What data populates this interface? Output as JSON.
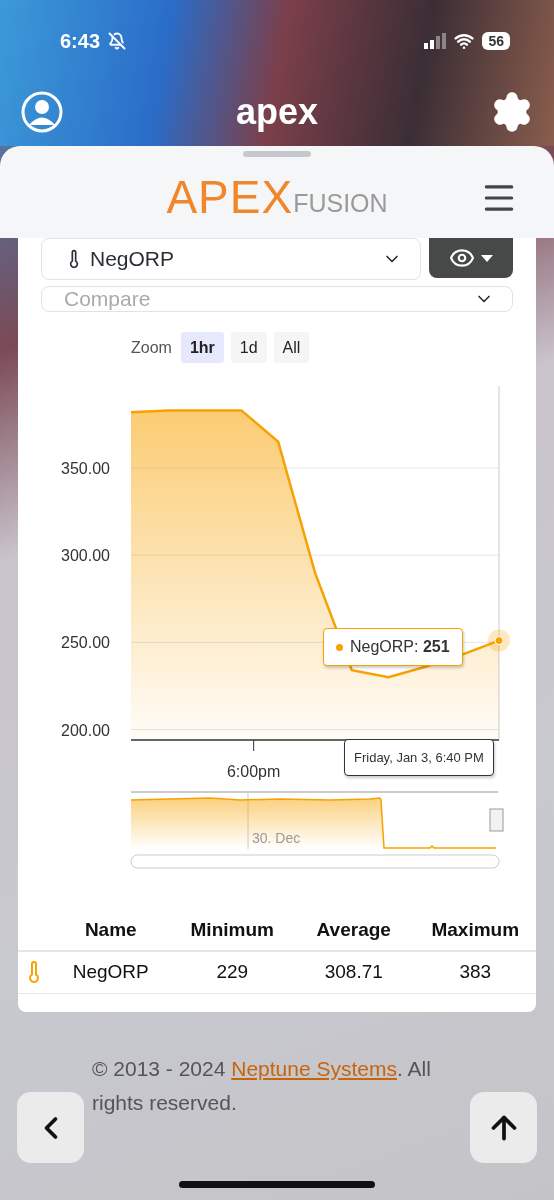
{
  "status_bar": {
    "time": "6:43",
    "battery": "56"
  },
  "app_header": {
    "title": "apex"
  },
  "sheet": {
    "logo": {
      "primary": "APEX",
      "secondary": "FUSION"
    }
  },
  "selectors": {
    "sensor": {
      "value": "NegORP"
    },
    "compare": {
      "placeholder": "Compare"
    }
  },
  "zoom": {
    "label": "Zoom",
    "options": [
      {
        "label": "1hr",
        "selected": true
      },
      {
        "label": "1d",
        "selected": false
      },
      {
        "label": "All",
        "selected": false
      }
    ]
  },
  "chart": {
    "chart_data": {
      "type": "area",
      "grid": true,
      "categories": [
        null,
        null,
        null,
        null,
        null,
        null,
        null,
        null,
        null,
        null,
        null
      ],
      "series": [
        {
          "name": "NegORP",
          "color": "#f7a200",
          "values": [
            382,
            383,
            383,
            383,
            365,
            290,
            234,
            230,
            236,
            243,
            251
          ]
        }
      ],
      "ylim": [
        194,
        397
      ],
      "yticks": [
        {
          "value": 200,
          "label": "200.00"
        },
        {
          "value": 250,
          "label": "250.00"
        },
        {
          "value": 300,
          "label": "300.00"
        },
        {
          "value": 350,
          "label": "350.00"
        }
      ],
      "annotations": [
        {
          "text": "6:00pm"
        }
      ]
    },
    "tooltip": {
      "separator": ":",
      "value": "251"
    },
    "time_tooltip": "Friday, Jan 3, 6:40 PM",
    "navigator": {
      "label": "30. Dec"
    }
  },
  "table": {
    "columns": [
      "Name",
      "Minimum",
      "Average",
      "Maximum"
    ],
    "rows": [
      {
        "name": "NegORP",
        "minimum": "229",
        "average": "308.71",
        "maximum": "383"
      }
    ]
  },
  "footer": {
    "prefix": "© 2013 - 2024 ",
    "link": "Neptune Systems",
    "suffix": ". All rights reserved."
  }
}
